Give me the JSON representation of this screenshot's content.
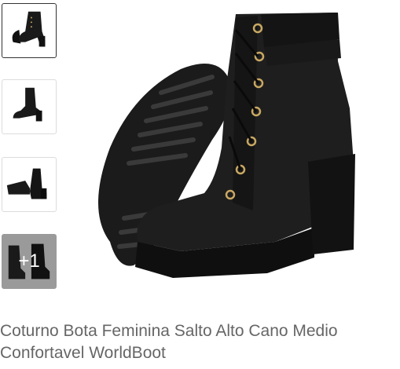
{
  "gallery": {
    "thumbnails": [
      {
        "alt": "boot-front-view"
      },
      {
        "alt": "boot-side-view"
      },
      {
        "alt": "boot-pair-lying"
      },
      {
        "alt": "boot-pair-more",
        "more_label": "+1"
      }
    ],
    "selected_index": 0
  },
  "product": {
    "title": "Coturno Bota Feminina Salto Alto Cano Medio Confortavel WorldBoot"
  }
}
